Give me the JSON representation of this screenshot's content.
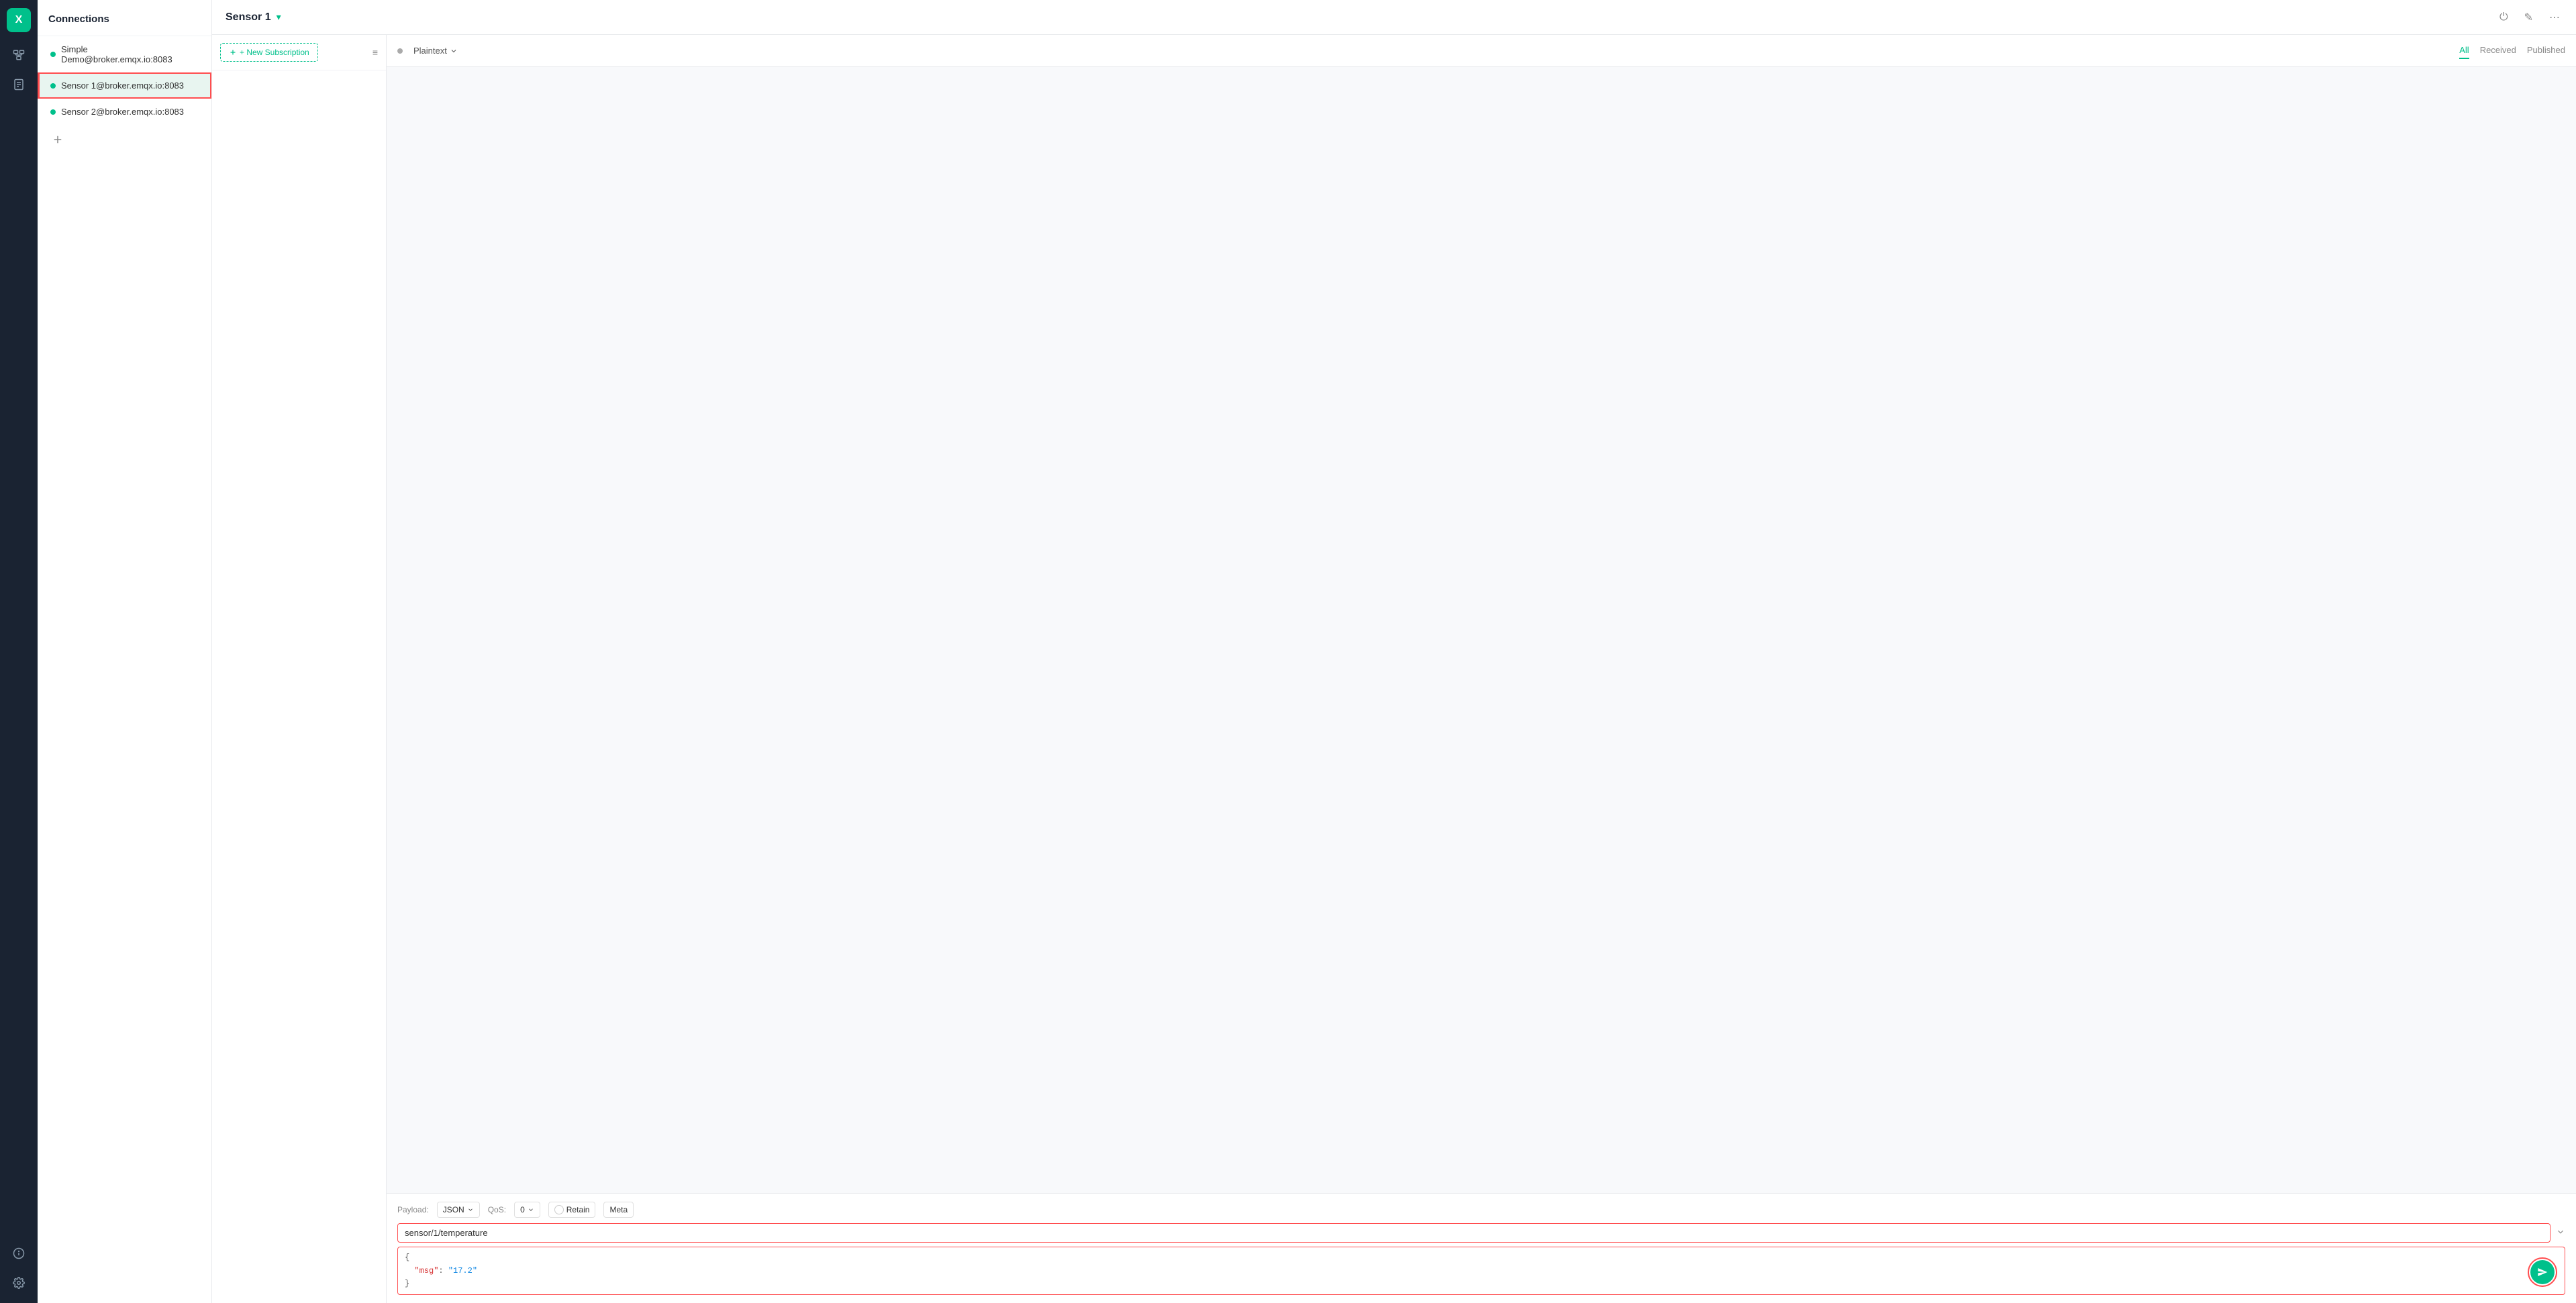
{
  "app": {
    "logo_text": "X",
    "logo_bg": "#00c08b"
  },
  "connections": {
    "header": "Connections",
    "items": [
      {
        "id": "simple-demo",
        "label": "Simple Demo@broker.emqx.io:8083",
        "active": false,
        "dot_color": "green"
      },
      {
        "id": "sensor-1",
        "label": "Sensor 1@broker.emqx.io:8083",
        "active": true,
        "dot_color": "green"
      },
      {
        "id": "sensor-2",
        "label": "Sensor 2@broker.emqx.io:8083",
        "active": false,
        "dot_color": "green"
      }
    ],
    "add_label": "+"
  },
  "main_header": {
    "title": "Sensor 1",
    "dropdown_symbol": "▾"
  },
  "header_actions": {
    "power": "⏻",
    "edit": "✎",
    "more": "⋯"
  },
  "subscriptions": {
    "new_subscription_label": "+ New Subscription",
    "filter_icon": "≡"
  },
  "messages": {
    "payload_type": "Plaintext",
    "filters": [
      {
        "id": "all",
        "label": "All",
        "active": true
      },
      {
        "id": "received",
        "label": "Received",
        "active": false
      },
      {
        "id": "published",
        "label": "Published",
        "active": false
      }
    ]
  },
  "publish": {
    "payload_label": "Payload:",
    "payload_type": "JSON",
    "qos_label": "QoS:",
    "qos_value": "0",
    "retain_label": "Retain",
    "meta_label": "Meta",
    "topic_value": "sensor/1/temperature",
    "payload_lines": [
      "{",
      "  \"msg\": \"17.2\"",
      "}"
    ],
    "send_icon": "➤"
  }
}
